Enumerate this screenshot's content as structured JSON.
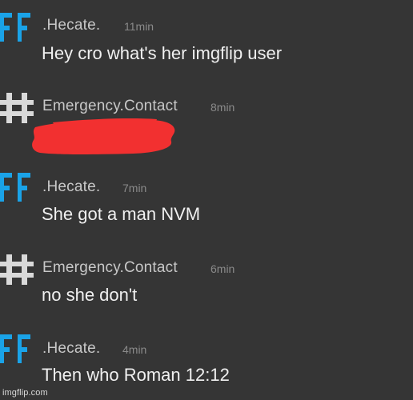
{
  "messages": [
    {
      "avatar": "ff-icon",
      "author": ".Hecate.",
      "time": "11min",
      "text": "Hey cro what's her imgflip user"
    },
    {
      "avatar": "hash-icon",
      "author": "Emergency.Contact",
      "time": "8min",
      "text": "",
      "redacted": true
    },
    {
      "avatar": "ff-icon",
      "author": ".Hecate.",
      "time": "7min",
      "text": "She got a man NVM"
    },
    {
      "avatar": "hash-icon",
      "author": "Emergency.Contact",
      "time": "6min",
      "text": "no she don't"
    },
    {
      "avatar": "ff-icon",
      "author": ".Hecate.",
      "time": "4min",
      "text": "Then who Roman 12:12"
    }
  ],
  "colors": {
    "background": "#353535",
    "ff_avatar": "#1aa3e8",
    "hash_avatar": "#d9d9d9",
    "redaction": "#f23030"
  },
  "watermark": "imgflip.com"
}
